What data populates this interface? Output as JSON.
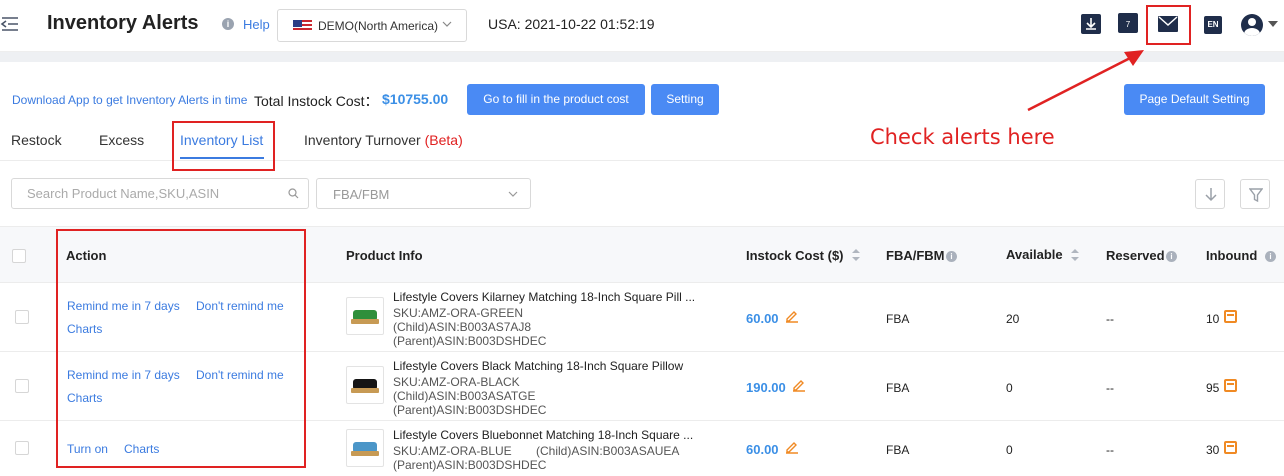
{
  "header": {
    "title": "Inventory Alerts",
    "help": "Help",
    "region": "DEMO(North America)",
    "datetime": "USA: 2021-10-22 01:52:19",
    "calendar_day": "7",
    "language": "EN"
  },
  "toolbar": {
    "download_app": "Download App to get Inventory Alerts in time",
    "total_label": "Total Instock Cost：",
    "total_value": "$10755.00",
    "fill_cost_button": "Go to fill in the product cost",
    "setting_button": "Setting",
    "page_default_button": "Page Default Setting"
  },
  "tabs": {
    "restock": "Restock",
    "excess": "Excess",
    "inventory_list": "Inventory List",
    "turnover": "Inventory Turnover",
    "turnover_beta": "(Beta)",
    "active": "Inventory List"
  },
  "annotation": {
    "text": "Check alerts here",
    "color": "#e02222"
  },
  "filters": {
    "search_placeholder": "Search Product Name,SKU,ASIN",
    "fulfillment_placeholder": "FBA/FBM"
  },
  "table": {
    "headers": {
      "action": "Action",
      "product_info": "Product Info",
      "instock_cost": "Instock Cost ($)",
      "fba_fbm": "FBA/FBM",
      "available": "Available",
      "reserved": "Reserved",
      "inbound": "Inbound"
    },
    "rows": [
      {
        "actions": [
          "Remind me in 7 days",
          "Don't remind me",
          "Charts"
        ],
        "name": "Lifestyle Covers Kilarney Matching 18-Inch Square Pill ...",
        "sku": "SKU:AMZ-ORA-GREEN",
        "child_asin": "(Child)ASIN:B003AS7AJ8",
        "parent_asin": "(Parent)ASIN:B003DSHDEC",
        "cost": "60.00",
        "fulfillment": "FBA",
        "available": "20",
        "reserved": "--",
        "inbound": "10",
        "thumb_color": "green"
      },
      {
        "actions": [
          "Remind me in 7 days",
          "Don't remind me",
          "Charts"
        ],
        "name": "Lifestyle Covers Black Matching 18-Inch Square Pillow",
        "sku": "SKU:AMZ-ORA-BLACK",
        "child_asin": "(Child)ASIN:B003ASATGE",
        "parent_asin": "(Parent)ASIN:B003DSHDEC",
        "cost": "190.00",
        "fulfillment": "FBA",
        "available": "0",
        "reserved": "--",
        "inbound": "95",
        "thumb_color": "black"
      },
      {
        "actions": [
          "Turn on",
          "Charts"
        ],
        "name": "Lifestyle Covers Bluebonnet Matching 18-Inch Square ...",
        "sku": "SKU:AMZ-ORA-BLUE",
        "child_asin": "(Child)ASIN:B003ASAUEA",
        "parent_asin": "(Parent)ASIN:B003DSHDEC",
        "cost": "60.00",
        "fulfillment": "FBA",
        "available": "0",
        "reserved": "--",
        "inbound": "30",
        "thumb_color": "blue"
      }
    ]
  },
  "icons": {
    "menu": "menu-collapse-icon",
    "download": "download-icon",
    "calendar": "calendar-icon",
    "mail": "mail-icon",
    "avatar": "user-avatar-icon",
    "search": "search-icon",
    "filter": "filter-icon",
    "edit": "edit-icon",
    "inbound": "shipment-icon"
  },
  "colors": {
    "accent": "#3b7be0",
    "button": "#4a8af4",
    "annotation": "#e02222",
    "cost": "#3b8fe6",
    "inbound_icon": "#f08a24"
  }
}
